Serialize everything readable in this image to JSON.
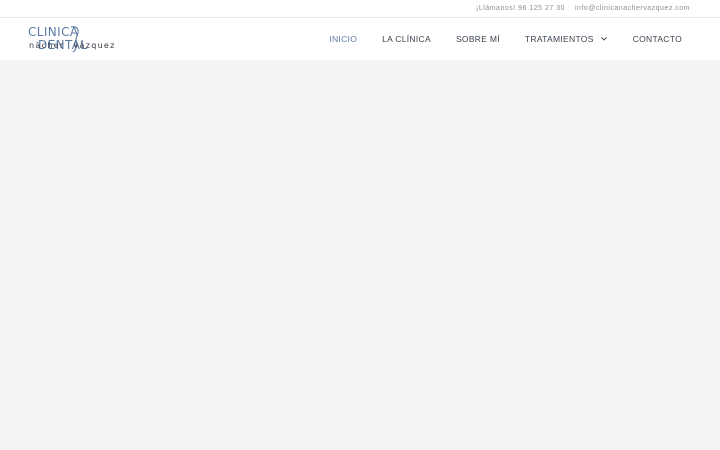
{
  "topbar": {
    "phone": "¡Llámanos! 96 125 27 30",
    "email": "info@clinicanachervazquez.com"
  },
  "logo": {
    "word1": "CLINICA",
    "word2": "DENTAL",
    "word3": "nàcher",
    "word4": "vàzquez"
  },
  "nav": {
    "items": [
      {
        "label": "INICIO"
      },
      {
        "label": "LA CLÍNICA"
      },
      {
        "label": "SOBRE MÍ"
      },
      {
        "label": "TRATAMIENTOS"
      },
      {
        "label": "CONTACTO"
      }
    ]
  },
  "colors": {
    "accent": "#5b7aa3",
    "text": "#3b4450",
    "background": "#f4f4f4"
  }
}
